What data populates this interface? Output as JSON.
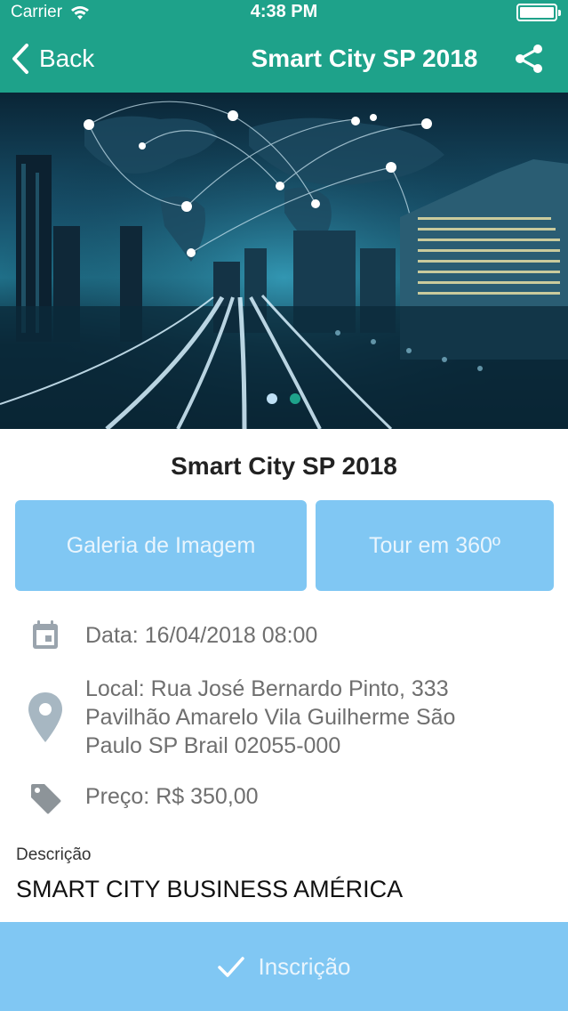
{
  "status_bar": {
    "carrier": "Carrier",
    "time": "4:38 PM"
  },
  "nav": {
    "back_label": "Back",
    "title": "Smart City SP 2018"
  },
  "carousel": {
    "page_count": 2,
    "active_index": 1,
    "active_color": "#1ea28a",
    "inactive_color": "#bfe0f5"
  },
  "event": {
    "title": "Smart City SP 2018",
    "gallery_button": "Galeria de Imagem",
    "tour_button": "Tour em 360º",
    "date": "Data: 16/04/2018 08:00",
    "location_line1": "Local: Rua José Bernardo Pinto, 333",
    "location_line2": "Pavilhão Amarelo Vila Guilherme São",
    "location_line3": "Paulo SP Brail 02055-000",
    "price": "Preço: R$ 350,00",
    "description_label": "Descrição",
    "description": "SMART CITY BUSINESS AMÉRICA"
  },
  "footer": {
    "register_label": "Inscrição"
  },
  "colors": {
    "header": "#1ea28a",
    "button": "#80c7f3",
    "button_text": "#e9f5fd"
  },
  "icons": [
    "wifi-icon",
    "battery-icon",
    "chevron-left-icon",
    "share-icon",
    "calendar-icon",
    "location-pin-icon",
    "price-tag-icon",
    "checkmark-icon"
  ]
}
